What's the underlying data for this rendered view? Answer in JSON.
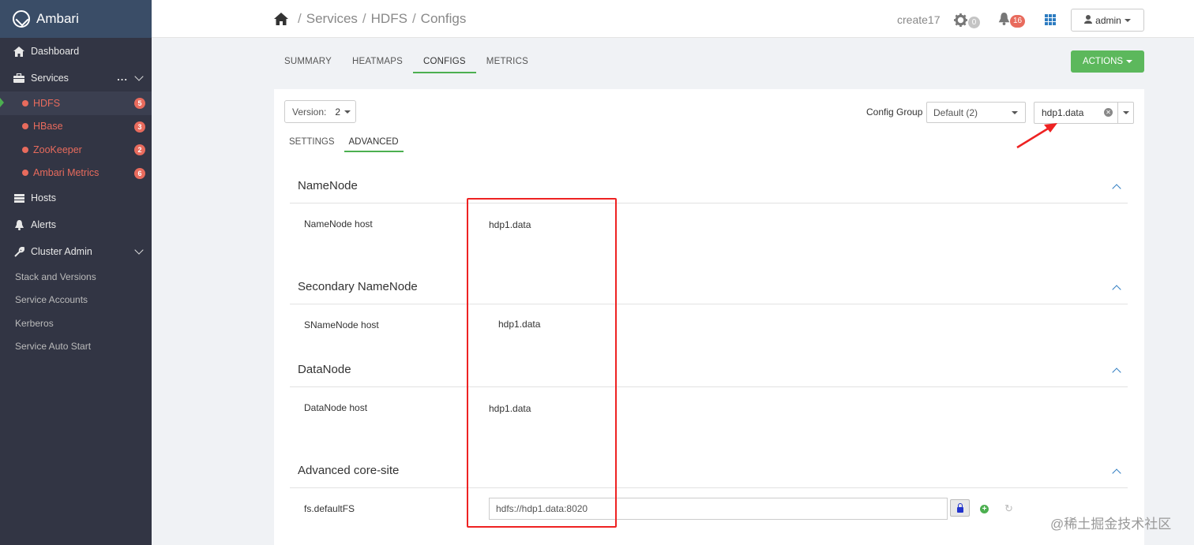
{
  "sidebar": {
    "brand": "Ambari",
    "dashboard": "Dashboard",
    "services": "Services",
    "services_more": "...",
    "service_items": [
      {
        "label": "HDFS",
        "count": "5"
      },
      {
        "label": "HBase",
        "count": "3"
      },
      {
        "label": "ZooKeeper",
        "count": "2"
      },
      {
        "label": "Ambari Metrics",
        "count": "6"
      }
    ],
    "hosts": "Hosts",
    "alerts": "Alerts",
    "cluster_admin": "Cluster Admin",
    "admin_links": [
      "Stack and Versions",
      "Service Accounts",
      "Kerberos",
      "Service Auto Start"
    ],
    "colors": {
      "bg": "#323544",
      "alert": "#e86b5d",
      "active_marker": "#4caf50"
    }
  },
  "topbar": {
    "crumbs": [
      "Services",
      "HDFS",
      "Configs"
    ],
    "separator": "/",
    "cluster_name": "create17",
    "ops_count": "0",
    "alerts_count": "16",
    "user": "admin"
  },
  "tabs": [
    "SUMMARY",
    "HEATMAPS",
    "CONFIGS",
    "METRICS"
  ],
  "active_tab": "CONFIGS",
  "actions_label": "ACTIONS",
  "config": {
    "version_label": "Version:",
    "version_value": "2",
    "config_group_label": "Config Group",
    "config_group_value": "Default (2)",
    "host_filter_value": "hdp1.data",
    "subtabs": [
      "SETTINGS",
      "ADVANCED"
    ],
    "active_subtab": "ADVANCED",
    "sections": [
      {
        "title": "NameNode",
        "prop": "NameNode host",
        "value": "hdp1.data"
      },
      {
        "title": "Secondary NameNode",
        "prop": "SNameNode host",
        "value": "hdp1.data"
      },
      {
        "title": "DataNode",
        "prop": "DataNode host",
        "value": "hdp1.data"
      },
      {
        "title": "Advanced core-site",
        "prop": "fs.defaultFS",
        "value": "hdfs://hdp1.data:8020"
      }
    ]
  },
  "watermark": "@稀土掘金技术社区"
}
